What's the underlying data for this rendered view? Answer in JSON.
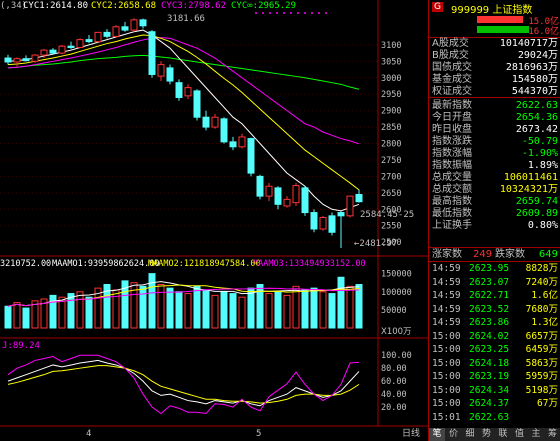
{
  "colors": {
    "up": "#ff3232",
    "down": "#54fcfc",
    "cyc1": "#ffffff",
    "cyc2": "#ffff00",
    "cyc3": "#ff00ff",
    "cycinf": "#00ff00",
    "label": "#c0c0c0",
    "grid": "#a00000"
  },
  "main_legend": {
    "prefix": "(,34)",
    "cyc1": "CYC1:2614.80",
    "cyc2": "CYC2:2658.68",
    "cyc3": "CYC3:2798.62",
    "cycinf": "CYC∞:2965.29"
  },
  "main_axis": {
    "ticks": [
      "3100",
      "3050",
      "3000",
      "2950",
      "2900",
      "2850",
      "2800",
      "2750",
      "2700",
      "2650",
      "2600",
      "2550",
      "2500"
    ]
  },
  "annotations": {
    "high": "3181.66",
    "low": "←2481.97",
    "mid": "2584.45-25"
  },
  "volume_legend": {
    "a": "3210752.00",
    "b": "MAAMO1:93959862624.00",
    "c": "MAAMO2:121818947584.00",
    "d": "MAAMO3:133494933152.00"
  },
  "volume_axis": {
    "ticks": [
      "150000",
      "100000",
      "50000"
    ],
    "unit": "X100万"
  },
  "ind_legend": {
    "name": "J:89.24"
  },
  "ind_axis": {
    "ticks": [
      "100.00",
      "80.00",
      "60.00",
      "40.00",
      "20.00"
    ]
  },
  "time_labels": [
    "4",
    "5"
  ],
  "chart_data": {
    "type": "candlestick",
    "y_range": [
      2470,
      3200
    ],
    "candles": [
      {
        "o": 3060,
        "h": 3070,
        "l": 3040,
        "c": 3048
      },
      {
        "o": 3048,
        "h": 3062,
        "l": 3035,
        "c": 3058
      },
      {
        "o": 3058,
        "h": 3068,
        "l": 3050,
        "c": 3052
      },
      {
        "o": 3050,
        "h": 3072,
        "l": 3045,
        "c": 3069
      },
      {
        "o": 3069,
        "h": 3088,
        "l": 3060,
        "c": 3084
      },
      {
        "o": 3084,
        "h": 3090,
        "l": 3070,
        "c": 3075
      },
      {
        "o": 3075,
        "h": 3100,
        "l": 3072,
        "c": 3096
      },
      {
        "o": 3096,
        "h": 3110,
        "l": 3088,
        "c": 3092
      },
      {
        "o": 3092,
        "h": 3120,
        "l": 3090,
        "c": 3116
      },
      {
        "o": 3116,
        "h": 3130,
        "l": 3105,
        "c": 3110
      },
      {
        "o": 3110,
        "h": 3140,
        "l": 3108,
        "c": 3138
      },
      {
        "o": 3138,
        "h": 3148,
        "l": 3120,
        "c": 3126
      },
      {
        "o": 3126,
        "h": 3160,
        "l": 3122,
        "c": 3155
      },
      {
        "o": 3155,
        "h": 3170,
        "l": 3140,
        "c": 3145
      },
      {
        "o": 3145,
        "h": 3181,
        "l": 3140,
        "c": 3176
      },
      {
        "o": 3176,
        "h": 3180,
        "l": 3150,
        "c": 3158
      },
      {
        "o": 3140,
        "h": 3145,
        "l": 3000,
        "c": 3010
      },
      {
        "o": 3005,
        "h": 3050,
        "l": 2990,
        "c": 3040
      },
      {
        "o": 3030,
        "h": 3040,
        "l": 2980,
        "c": 2990
      },
      {
        "o": 2985,
        "h": 2995,
        "l": 2930,
        "c": 2940
      },
      {
        "o": 2945,
        "h": 2980,
        "l": 2935,
        "c": 2970
      },
      {
        "o": 2960,
        "h": 2965,
        "l": 2870,
        "c": 2880
      },
      {
        "o": 2880,
        "h": 2900,
        "l": 2840,
        "c": 2850
      },
      {
        "o": 2850,
        "h": 2890,
        "l": 2845,
        "c": 2880
      },
      {
        "o": 2875,
        "h": 2880,
        "l": 2800,
        "c": 2805
      },
      {
        "o": 2805,
        "h": 2820,
        "l": 2780,
        "c": 2790
      },
      {
        "o": 2790,
        "h": 2830,
        "l": 2785,
        "c": 2820
      },
      {
        "o": 2815,
        "h": 2818,
        "l": 2700,
        "c": 2710
      },
      {
        "o": 2700,
        "h": 2705,
        "l": 2630,
        "c": 2640
      },
      {
        "o": 2640,
        "h": 2680,
        "l": 2625,
        "c": 2670
      },
      {
        "o": 2665,
        "h": 2670,
        "l": 2600,
        "c": 2615
      },
      {
        "o": 2610,
        "h": 2640,
        "l": 2605,
        "c": 2630
      },
      {
        "o": 2620,
        "h": 2680,
        "l": 2610,
        "c": 2672
      },
      {
        "o": 2665,
        "h": 2670,
        "l": 2580,
        "c": 2590
      },
      {
        "o": 2590,
        "h": 2600,
        "l": 2530,
        "c": 2540
      },
      {
        "o": 2540,
        "h": 2580,
        "l": 2535,
        "c": 2575
      },
      {
        "o": 2580,
        "h": 2590,
        "l": 2520,
        "c": 2530
      },
      {
        "o": 2590,
        "h": 2595,
        "l": 2482,
        "c": 2580
      },
      {
        "o": 2580,
        "h": 2640,
        "l": 2575,
        "c": 2640
      },
      {
        "o": 2645,
        "h": 2660,
        "l": 2620,
        "c": 2623
      }
    ],
    "volumes": [
      60,
      70,
      55,
      75,
      80,
      90,
      85,
      95,
      100,
      85,
      110,
      120,
      105,
      130,
      125,
      115,
      150,
      120,
      110,
      100,
      95,
      115,
      105,
      90,
      100,
      95,
      85,
      110,
      120,
      95,
      100,
      90,
      115,
      105,
      110,
      100,
      95,
      140,
      115,
      120
    ],
    "ma_fast": [
      3050,
      3052,
      3055,
      3060,
      3066,
      3072,
      3078,
      3084,
      3092,
      3100,
      3108,
      3116,
      3124,
      3132,
      3140,
      3145,
      3130,
      3110,
      3090,
      3060,
      3030,
      3000,
      2970,
      2940,
      2910,
      2880,
      2860,
      2830,
      2800,
      2770,
      2740,
      2710,
      2690,
      2670,
      2640,
      2615,
      2600,
      2595,
      2605,
      2615
    ],
    "ma_mid": [
      3040,
      3042,
      3045,
      3050,
      3055,
      3060,
      3066,
      3072,
      3080,
      3088,
      3096,
      3104,
      3110,
      3118,
      3124,
      3130,
      3128,
      3120,
      3110,
      3095,
      3080,
      3062,
      3042,
      3020,
      2998,
      2978,
      2955,
      2930,
      2905,
      2880,
      2855,
      2830,
      2805,
      2780,
      2760,
      2740,
      2720,
      2700,
      2680,
      2659
    ],
    "ma_slow": [
      3030,
      3032,
      3035,
      3040,
      3045,
      3050,
      3055,
      3060,
      3066,
      3072,
      3078,
      3085,
      3092,
      3100,
      3108,
      3115,
      3120,
      3122,
      3120,
      3110,
      3100,
      3090,
      3075,
      3060,
      3040,
      3020,
      3000,
      2980,
      2960,
      2940,
      2920,
      2900,
      2880,
      2860,
      2850,
      2835,
      2825,
      2815,
      2808,
      2799
    ],
    "ma_long": [
      3030,
      3032,
      3035,
      3038,
      3040,
      3042,
      3045,
      3048,
      3052,
      3055,
      3058,
      3060,
      3062,
      3065,
      3067,
      3068,
      3066,
      3063,
      3060,
      3056,
      3052,
      3048,
      3044,
      3040,
      3036,
      3032,
      3028,
      3024,
      3020,
      3016,
      3012,
      3008,
      3004,
      3000,
      2995,
      2990,
      2985,
      2980,
      2972,
      2965
    ],
    "kdj_k": [
      60,
      65,
      70,
      75,
      80,
      85,
      82,
      85,
      88,
      90,
      92,
      88,
      85,
      80,
      72,
      60,
      45,
      38,
      40,
      35,
      30,
      28,
      25,
      30,
      28,
      26,
      30,
      25,
      22,
      30,
      35,
      40,
      50,
      45,
      40,
      35,
      38,
      45,
      60,
      75
    ],
    "kdj_d": [
      55,
      58,
      62,
      66,
      70,
      75,
      76,
      78,
      80,
      82,
      84,
      84,
      82,
      80,
      76,
      70,
      60,
      52,
      48,
      44,
      40,
      36,
      32,
      32,
      30,
      29,
      29,
      28,
      26,
      27,
      29,
      32,
      38,
      40,
      40,
      38,
      38,
      40,
      46,
      55
    ],
    "kdj_j": [
      70,
      80,
      85,
      92,
      95,
      98,
      90,
      95,
      100,
      100,
      100,
      95,
      90,
      80,
      65,
      40,
      20,
      10,
      22,
      18,
      12,
      12,
      10,
      25,
      24,
      20,
      32,
      20,
      14,
      36,
      46,
      56,
      74,
      55,
      40,
      30,
      38,
      55,
      88,
      89
    ]
  },
  "panel": {
    "badge": "G",
    "title": "999999 上证指数",
    "ratio_up": "15.0亿",
    "ratio_dn": "16.0亿",
    "stats": [
      {
        "k": "A股成交",
        "v": "10140717万",
        "c": "#ffffff"
      },
      {
        "k": "B股成交",
        "v": "29024万",
        "c": "#ffffff"
      },
      {
        "k": "国债成交",
        "v": "2816963万",
        "c": "#ffffff"
      },
      {
        "k": "基金成交",
        "v": "154580万",
        "c": "#ffffff"
      },
      {
        "k": "权证成交",
        "v": "544370万",
        "c": "#ffffff"
      }
    ],
    "quotes": [
      {
        "k": "最新指数",
        "v": "2622.63",
        "c": "#00ff00"
      },
      {
        "k": "今日开盘",
        "v": "2654.36",
        "c": "#00ff00"
      },
      {
        "k": "昨日收盘",
        "v": "2673.42",
        "c": "#ffffff"
      },
      {
        "k": "指数涨跌",
        "v": "-50.79",
        "c": "#00ff00"
      },
      {
        "k": "指数涨幅",
        "v": "-1.90%",
        "c": "#00ff00"
      },
      {
        "k": "指数振幅",
        "v": "1.89%",
        "c": "#ffffff"
      },
      {
        "k": "总成交量",
        "v": "106011461",
        "c": "#ffff00"
      },
      {
        "k": "总成交额",
        "v": "10324321万",
        "c": "#ffff00"
      },
      {
        "k": "最高指数",
        "v": "2659.74",
        "c": "#00ff00"
      },
      {
        "k": "最低指数",
        "v": "2609.89",
        "c": "#00ff00"
      },
      {
        "k": "上证换手",
        "v": "0.80%",
        "c": "#ffffff"
      }
    ],
    "breadth": {
      "up_label": "涨家数",
      "up": "249",
      "dn_label": "跌家数",
      "dn": "649"
    },
    "ticks": [
      {
        "t": "14:59",
        "p": "2623.95",
        "v": "8828万"
      },
      {
        "t": "14:59",
        "p": "2623.07",
        "v": "7240万"
      },
      {
        "t": "14:59",
        "p": "2622.71",
        "v": "1.6亿"
      },
      {
        "t": "14:59",
        "p": "2623.52",
        "v": "7680万"
      },
      {
        "t": "14:59",
        "p": "2623.86",
        "v": "1.3亿"
      },
      {
        "t": "15:00",
        "p": "2624.02",
        "v": "6657万"
      },
      {
        "t": "15:00",
        "p": "2623.25",
        "v": "6459万"
      },
      {
        "t": "15:00",
        "p": "2624.18",
        "v": "5863万"
      },
      {
        "t": "15:00",
        "p": "2623.19",
        "v": "5959万"
      },
      {
        "t": "15:00",
        "p": "2624.34",
        "v": "5198万"
      },
      {
        "t": "15:00",
        "p": "2624.37",
        "v": "67万"
      },
      {
        "t": "15:01",
        "p": "2622.63",
        "v": ""
      }
    ],
    "tabs": [
      "笔",
      "价",
      "细",
      "势",
      "联",
      "值",
      "主",
      "筹"
    ],
    "bottom_tab": "日线"
  }
}
